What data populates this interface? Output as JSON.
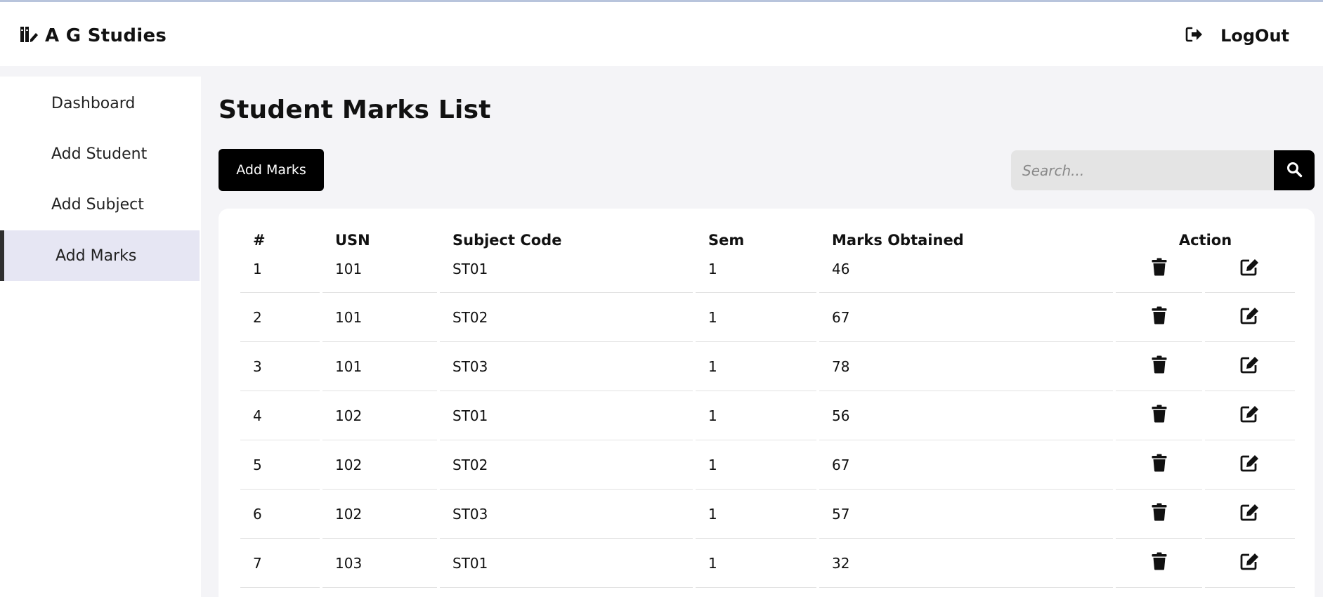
{
  "app": {
    "title": "A G Studies",
    "logout_label": "LogOut"
  },
  "sidebar": {
    "items": [
      {
        "label": "Dashboard",
        "active": false
      },
      {
        "label": "Add Student",
        "active": false
      },
      {
        "label": "Add Subject",
        "active": false
      },
      {
        "label": "Add Marks",
        "active": true
      }
    ]
  },
  "main": {
    "title": "Student Marks List",
    "add_button_label": "Add Marks",
    "search": {
      "placeholder": "Search...",
      "value": ""
    }
  },
  "table": {
    "headers": [
      "#",
      "USN",
      "Subject Code",
      "Sem",
      "Marks Obtained",
      "Action"
    ],
    "rows": [
      {
        "num": "1",
        "usn": "101",
        "subject_code": "ST01",
        "sem": "1",
        "marks": "46"
      },
      {
        "num": "2",
        "usn": "101",
        "subject_code": "ST02",
        "sem": "1",
        "marks": "67"
      },
      {
        "num": "3",
        "usn": "101",
        "subject_code": "ST03",
        "sem": "1",
        "marks": "78"
      },
      {
        "num": "4",
        "usn": "102",
        "subject_code": "ST01",
        "sem": "1",
        "marks": "56"
      },
      {
        "num": "5",
        "usn": "102",
        "subject_code": "ST02",
        "sem": "1",
        "marks": "67"
      },
      {
        "num": "6",
        "usn": "102",
        "subject_code": "ST03",
        "sem": "1",
        "marks": "57"
      },
      {
        "num": "7",
        "usn": "103",
        "subject_code": "ST01",
        "sem": "1",
        "marks": "32"
      }
    ]
  },
  "icons": {
    "brand": "book-pen-icon",
    "logout": "sign-out-icon",
    "search": "search-icon",
    "delete": "trash-icon",
    "edit": "edit-icon"
  },
  "colors": {
    "accent": "#000000",
    "page_bg": "#f4f4f7",
    "active_nav_bg": "#e6e6f3",
    "search_bg": "#e4e4e4"
  }
}
